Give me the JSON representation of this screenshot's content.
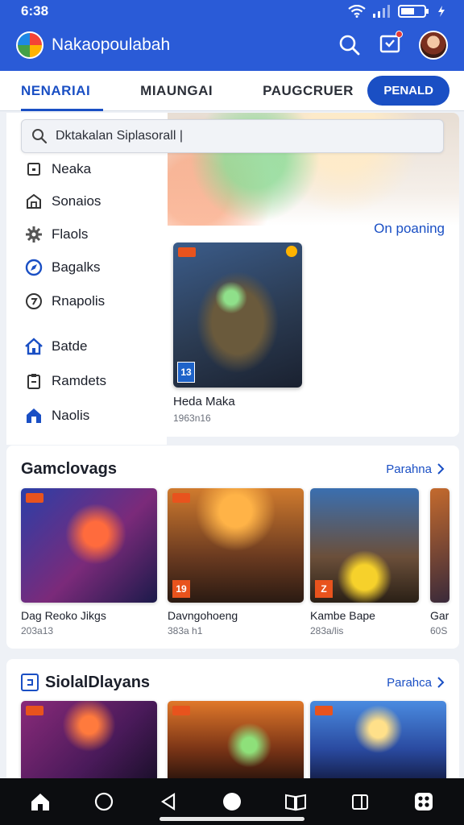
{
  "status": {
    "time": "6:38"
  },
  "app": {
    "title": "Nakaopoulabah"
  },
  "tabs": [
    {
      "label": "NENARIAI"
    },
    {
      "label": "MIAUNGAI"
    },
    {
      "label": "PAUGCRUER"
    }
  ],
  "tab_button": {
    "label": "PENALD"
  },
  "search": {
    "value": "Dktakalan Siplasorall |"
  },
  "menu": [
    {
      "label": "Neaka",
      "icon": "square-icon"
    },
    {
      "label": "Sonaios",
      "icon": "store-icon"
    },
    {
      "label": "Flaols",
      "icon": "gear-icon"
    },
    {
      "label": "Bagalks",
      "icon": "compass-icon"
    },
    {
      "label": "Rnapolis",
      "icon": "clock-icon"
    },
    {
      "label": "Batde",
      "icon": "home-icon"
    },
    {
      "label": "Ramdets",
      "icon": "clipboard-icon"
    },
    {
      "label": "Naolis",
      "icon": "house-filled-icon"
    }
  ],
  "hero": {
    "link": "On poaning",
    "rating": "13",
    "title": "Heda Maka",
    "subtitle": "1963n16"
  },
  "sections": [
    {
      "title": "Gamclovags",
      "link": "Parahna",
      "games": [
        {
          "name": "Dag Reoko Jikgs",
          "meta": "203a13"
        },
        {
          "name": "Davngohoeng",
          "meta": "383a h1",
          "rating": "19"
        },
        {
          "name": "Kambe Bape",
          "meta": "283a/lis",
          "rating": "Z"
        },
        {
          "name": "Gar",
          "meta": "60S"
        }
      ]
    },
    {
      "title": "SiolalDlayans",
      "link": "Parahca"
    }
  ],
  "colors": {
    "brand": "#2a5bd7",
    "accent": "#1a4fc4",
    "badge": "#e8531d",
    "nav_bg": "#0c0d10"
  }
}
